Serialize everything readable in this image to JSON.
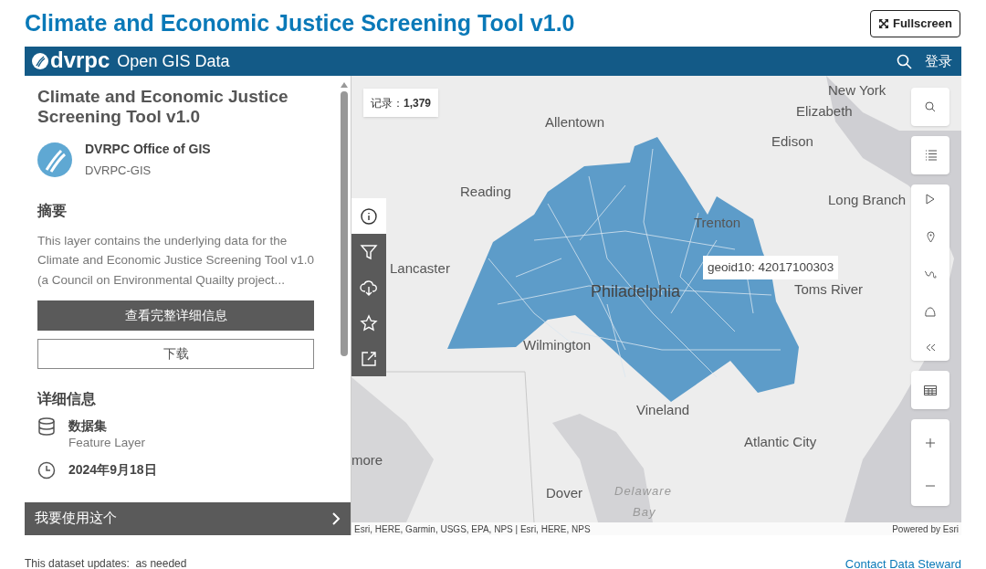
{
  "page_title": "Climate and Economic Justice Screening Tool v1.0",
  "fullscreen_button": "Fullscreen",
  "header": {
    "logo": "dvrpc",
    "site_name": "Open GIS Data",
    "sign_in": "登录"
  },
  "item": {
    "title": "Climate and Economic Justice Screening Tool v1.0",
    "owner": "DVRPC Office of GIS",
    "owner_id": "DVRPC-GIS",
    "summary_heading": "摘要",
    "summary": "This layer contains the underlying data for the Climate and Economic Justice Screening Tool v1.0 (a Council on Environmental Quailty project...",
    "view_details_button": "查看完整详细信息",
    "download_button": "下载",
    "details_heading": "详细信息",
    "details": [
      {
        "kind": "dataset",
        "label": "数据集",
        "value": "Feature Layer"
      },
      {
        "kind": "date",
        "label": "2024年9月18日"
      }
    ],
    "use_bar": "我要使用这个"
  },
  "side_tools": [
    {
      "kind": "info",
      "selected": true
    },
    {
      "kind": "filter",
      "selected": false
    },
    {
      "kind": "download",
      "selected": false
    },
    {
      "kind": "favorite",
      "selected": false
    },
    {
      "kind": "share",
      "selected": false
    }
  ],
  "map": {
    "record_label": "记录：",
    "record_count": "1,379",
    "tooltip": "geoid10: 42017100303",
    "places": [
      {
        "name": "New York",
        "kind": "city"
      },
      {
        "name": "Elizabeth",
        "kind": "city"
      },
      {
        "name": "Edison",
        "kind": "city"
      },
      {
        "name": "Allentown",
        "kind": "city"
      },
      {
        "name": "Reading",
        "kind": "city"
      },
      {
        "name": "Long Branch",
        "kind": "city"
      },
      {
        "name": "Trenton",
        "kind": "city"
      },
      {
        "name": "Lancaster",
        "kind": "city"
      },
      {
        "name": "Philadelphia",
        "kind": "major"
      },
      {
        "name": "Toms River",
        "kind": "city"
      },
      {
        "name": "Wilmington",
        "kind": "city"
      },
      {
        "name": "Vineland",
        "kind": "city"
      },
      {
        "name": "Atlantic City",
        "kind": "city"
      },
      {
        "name": "more",
        "kind": "city"
      },
      {
        "name": "Dover",
        "kind": "city"
      },
      {
        "name": "Delaware",
        "kind": "water"
      },
      {
        "name": "Bay",
        "kind": "water"
      }
    ],
    "attribution": "Esri, HERE, Garmin, USGS, EPA, NPS | Esri, HERE, NPS",
    "powered_by": "Powered by Esri"
  },
  "footer": {
    "updates": "This dataset updates:  as needed",
    "contact_link": "Contact Data Steward"
  }
}
